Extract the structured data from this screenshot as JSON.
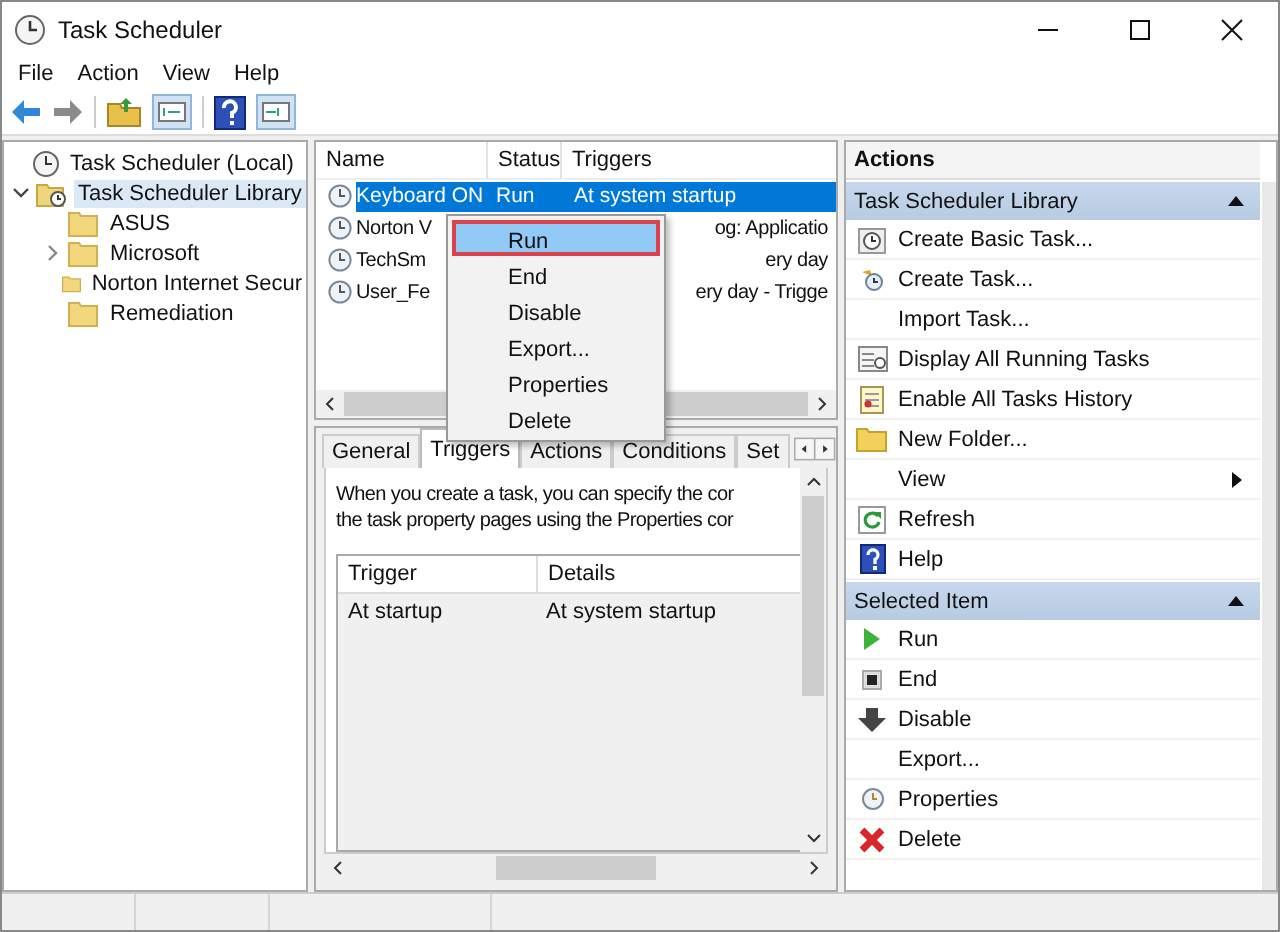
{
  "window": {
    "title": "Task Scheduler"
  },
  "menu": [
    "File",
    "Action",
    "View",
    "Help"
  ],
  "tree": [
    {
      "label": "Task Scheduler (Local)",
      "selected": false,
      "children": [
        {
          "label": "Task Scheduler Library",
          "selected": true,
          "expanded": true,
          "children": [
            {
              "label": "ASUS",
              "selected": false
            },
            {
              "label": "Microsoft",
              "selected": false,
              "expanded": false
            },
            {
              "label": "Norton Internet Secur",
              "selected": false
            },
            {
              "label": "Remediation",
              "selected": false
            }
          ]
        }
      ]
    }
  ],
  "task_list": {
    "columns": [
      "Name",
      "Status",
      "Triggers"
    ],
    "rows": [
      {
        "kind": "full",
        "name": "Keyboard ON",
        "status": "Run",
        "triggers": "At system startup",
        "selected": true
      },
      {
        "kind": "covered",
        "name": "Norton V",
        "triggers": "og: Applicatio",
        "selected": false
      },
      {
        "kind": "covered",
        "name": "TechSm",
        "triggers": "ery day",
        "selected": false
      },
      {
        "kind": "covered",
        "name": "User_Fe",
        "triggers": "ery day - Trigge",
        "selected": false
      }
    ]
  },
  "context_menu": [
    {
      "label": "Run",
      "selected": true
    },
    {
      "label": "End",
      "selected": false
    },
    {
      "label": "Disable",
      "selected": false
    },
    {
      "label": "Export...",
      "selected": false
    },
    {
      "label": "Properties",
      "selected": false
    },
    {
      "label": "Delete",
      "selected": false
    }
  ],
  "details": {
    "tabs": [
      {
        "label": "General",
        "selected": false
      },
      {
        "label": "Triggers",
        "selected": true
      },
      {
        "label": "Actions",
        "selected": false
      },
      {
        "label": "Conditions",
        "selected": false
      },
      {
        "label": "Set",
        "selected": false
      }
    ],
    "description": [
      "When you create a task, you can specify the cor",
      "the task property pages using the Properties cor"
    ],
    "columns": [
      "Trigger",
      "Details"
    ],
    "rows": [
      [
        "At startup",
        "At system startup"
      ]
    ]
  },
  "actions": {
    "title": "Actions",
    "sections": [
      {
        "title": "Task Scheduler Library",
        "expanded": true,
        "items": [
          {
            "label": "Create Basic Task..."
          },
          {
            "label": "Create Task..."
          },
          {
            "label": "Import Task..."
          },
          {
            "label": "Display All Running Tasks"
          },
          {
            "label": "Enable All Tasks History"
          },
          {
            "label": "New Folder..."
          },
          {
            "label": "View",
            "submenu": true
          },
          {
            "label": "Refresh"
          },
          {
            "label": "Help"
          }
        ]
      },
      {
        "title": "Selected Item",
        "expanded": true,
        "items": [
          {
            "label": "Run"
          },
          {
            "label": "End"
          },
          {
            "label": "Disable"
          },
          {
            "label": "Export..."
          },
          {
            "label": "Properties"
          },
          {
            "label": "Delete"
          }
        ]
      }
    ]
  }
}
